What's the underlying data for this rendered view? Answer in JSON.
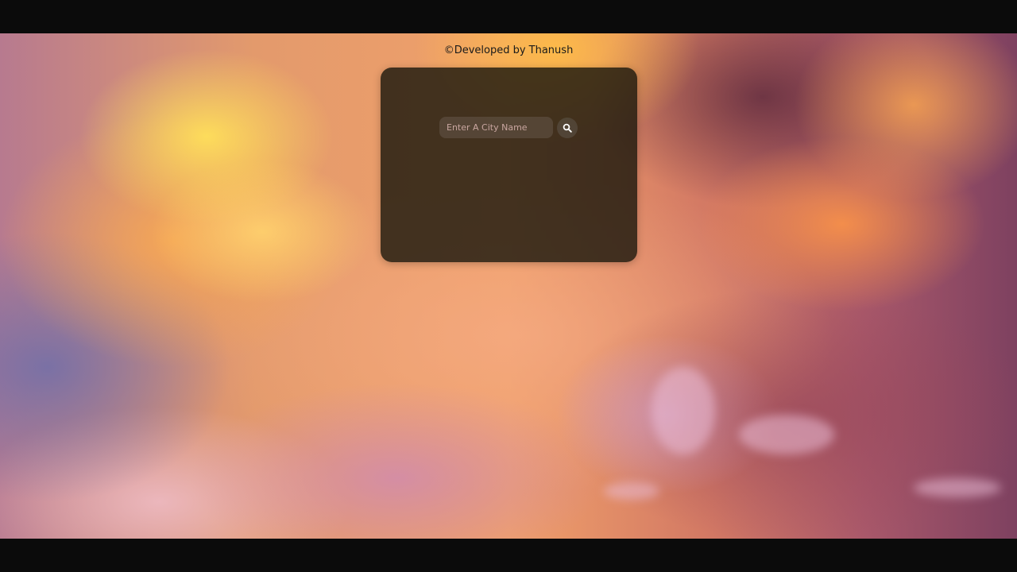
{
  "footer": {
    "credit": "©Developed by Thanush"
  },
  "search": {
    "placeholder": "Enter A City Name",
    "value": "",
    "button_icon": "search-icon"
  },
  "colors": {
    "card_background": "#1c180e",
    "letterbox": "#0b0b0b"
  }
}
